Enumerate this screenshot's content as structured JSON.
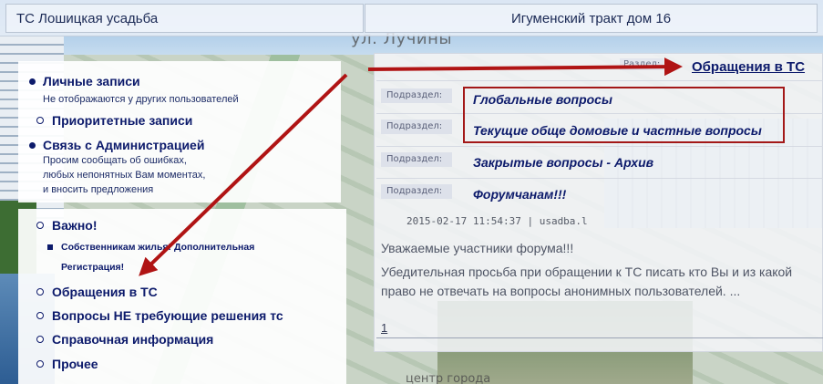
{
  "header": {
    "left_title": "ТС Лошицкая усадьба",
    "right_title": "Игуменский тракт дом 16"
  },
  "background": {
    "street_label": "ул. Лучины",
    "center_label": "центр города"
  },
  "menu_top": [
    {
      "label": "Личные записи",
      "desc": "Не отображаются у других пользователей",
      "bullet": "disc"
    },
    {
      "label": "Приоритетные записи",
      "bullet": "ring"
    },
    {
      "label": "Связь с Администрацией",
      "desc_lines": [
        "Просим сообщать об ошибках,",
        "любых непонятных Вам моментах,",
        "и вносить предложения"
      ],
      "bullet": "disc"
    }
  ],
  "menu_bottom": {
    "important": "Важно!",
    "owners_line1": "Собственникам жилья! Дополнительная",
    "owners_line2": "Регистрация!",
    "items": [
      "Обращения в ТС",
      "Вопросы НЕ требующие решения тс",
      "Справочная информация",
      "Прочее"
    ]
  },
  "content": {
    "section_label": "Раздел:",
    "section_title": "Обращения в ТС",
    "subsection_label": "Подраздел:",
    "subsections": [
      "Глобальные вопросы",
      "Текущие обще домовые и частные вопросы",
      "Закрытые вопросы - Архив",
      "Форумчанам!!!"
    ],
    "post_meta": "2015-02-17 11:54:37 | usadba.l",
    "post_lines": [
      "Уважаемые участники форума!!!",
      "Убедительная просьба при обращении к ТС писать кто Вы и из какой",
      "право не отвечать на вопросы анонимных пользователей. ..."
    ],
    "pagination": "1"
  },
  "colors": {
    "menu_text": "#0c1a6b",
    "highlight_border": "#a31818",
    "arrow": "#b01414"
  }
}
